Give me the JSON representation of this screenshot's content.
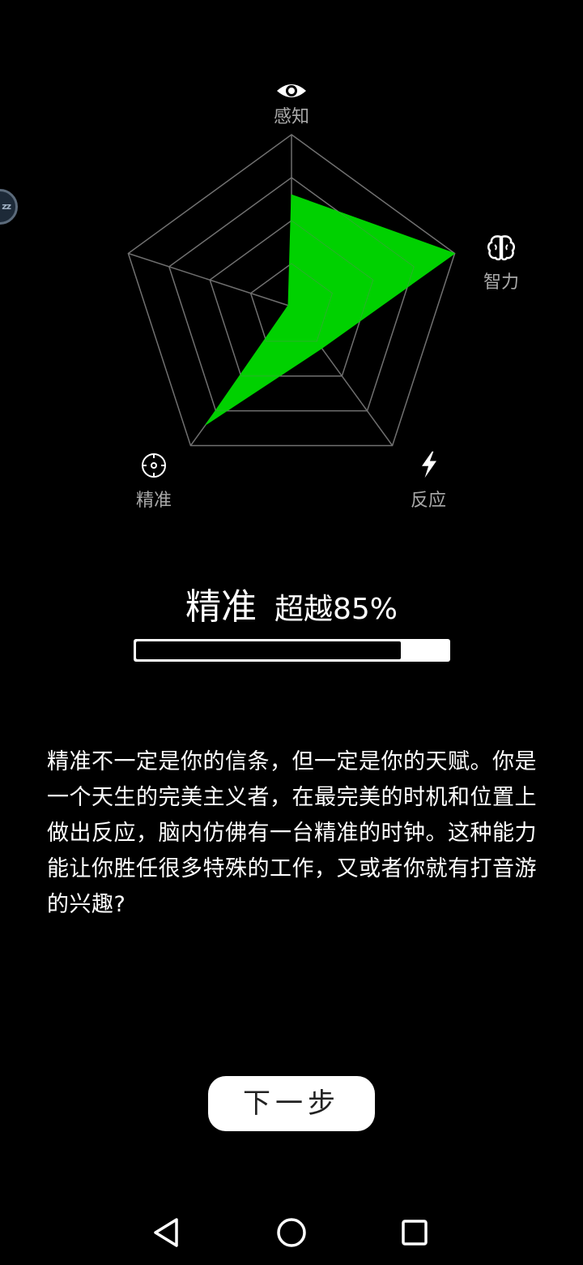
{
  "radar": {
    "axes": [
      {
        "key": "perception",
        "label": "感知",
        "icon": "eye-icon"
      },
      {
        "key": "intelligence",
        "label": "智力",
        "icon": "brain-icon"
      },
      {
        "key": "reaction",
        "label": "反应",
        "icon": "lightning-icon"
      },
      {
        "key": "precision",
        "label": "精准",
        "icon": "crosshair-icon"
      }
    ],
    "chart_data": {
      "type": "radar",
      "axes": [
        "感知",
        "智力",
        "反应",
        "精准",
        ""
      ],
      "values": [
        0.65,
        1.0,
        0.3,
        0.85,
        0.02
      ],
      "range": [
        0,
        1
      ],
      "rings": 4,
      "fill_color": "#00d100",
      "grid_color": "#6e6e6e"
    }
  },
  "floating_bubble": {
    "text": "zz"
  },
  "result": {
    "name": "精准",
    "value_text": "超越85%",
    "progress": 0.85
  },
  "description": "精准不一定是你的信条，但一定是你的天赋。你是一个天生的完美主义者，在最完美的时机和位置上做出反应，脑内仿佛有一台精准的时钟。这种能力能让你胜任很多特殊的工作，又或者你就有打音游的兴趣?",
  "next_button": {
    "label": "下一步"
  },
  "navbar": {
    "icons": [
      "back-triangle-icon",
      "home-circle-icon",
      "recents-square-icon"
    ]
  },
  "colors": {
    "background": "#000000",
    "accent": "#00d100",
    "label_gray": "#a9a9a9"
  }
}
